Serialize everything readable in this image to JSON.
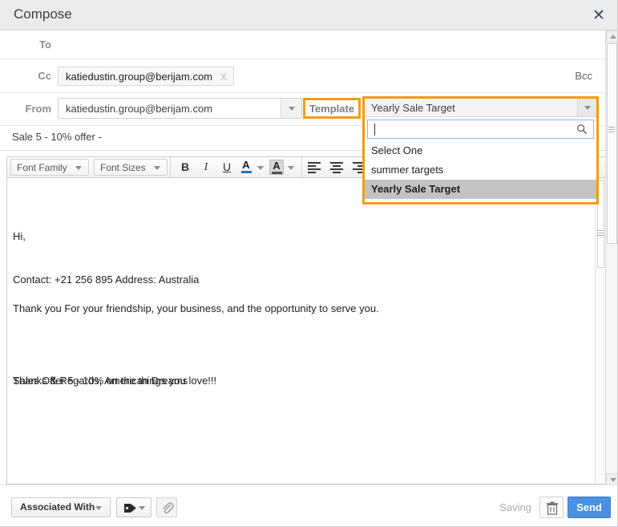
{
  "window": {
    "title": "Compose",
    "close_icon": "close-icon"
  },
  "fields": {
    "to_label": "To",
    "to_value": "",
    "cc_label": "Cc",
    "cc_chip": "katiedustin.group@berijam.com",
    "cc_chip_remove": "X",
    "bcc_label": "Bcc",
    "from_label": "From",
    "from_value": "katiedustin.group@berijam.com",
    "subject": "Sale 5 - 10% offer -"
  },
  "template_button": {
    "label": "Template"
  },
  "template_dropdown": {
    "selected": "Yearly Sale Target",
    "search_value": "",
    "search_icon": "search-icon",
    "options": [
      {
        "label": "Select One",
        "selected": false
      },
      {
        "label": "summer targets",
        "selected": false
      },
      {
        "label": "Yearly Sale Target",
        "selected": true
      }
    ],
    "highlight_color": "#f39c12",
    "selected_row_color": "#c3c3c3"
  },
  "editor_toolbar": {
    "font_family": "Font Family",
    "font_sizes": "Font Sizes",
    "bold": "B",
    "italic": "I",
    "underline": "U",
    "text_color": "A",
    "highlight_color": "A",
    "text_color_value": "#2a6fd1",
    "align_left": "align-left",
    "align_center": "align-center",
    "align_right": "align-right"
  },
  "body": {
    "greeting": "Hi,",
    "paragraph1": "Thank you For your friendship, your business, and the opportunity to serve you.",
    "paragraph2": "Sales Offer 5 - 10% on the things you love!!!",
    "contact": "Contact:  +21 256 895\nAddress: Australia",
    "signature": "Thanks & Regards,\nAmerican Dreams"
  },
  "footer": {
    "associated_with": "Associated With",
    "tag_icon": "tag-icon",
    "attach_icon": "paperclip-icon",
    "status": "Saving",
    "trash_icon": "trash-icon",
    "send_label": "Send",
    "send_color": "#4a90e2"
  }
}
